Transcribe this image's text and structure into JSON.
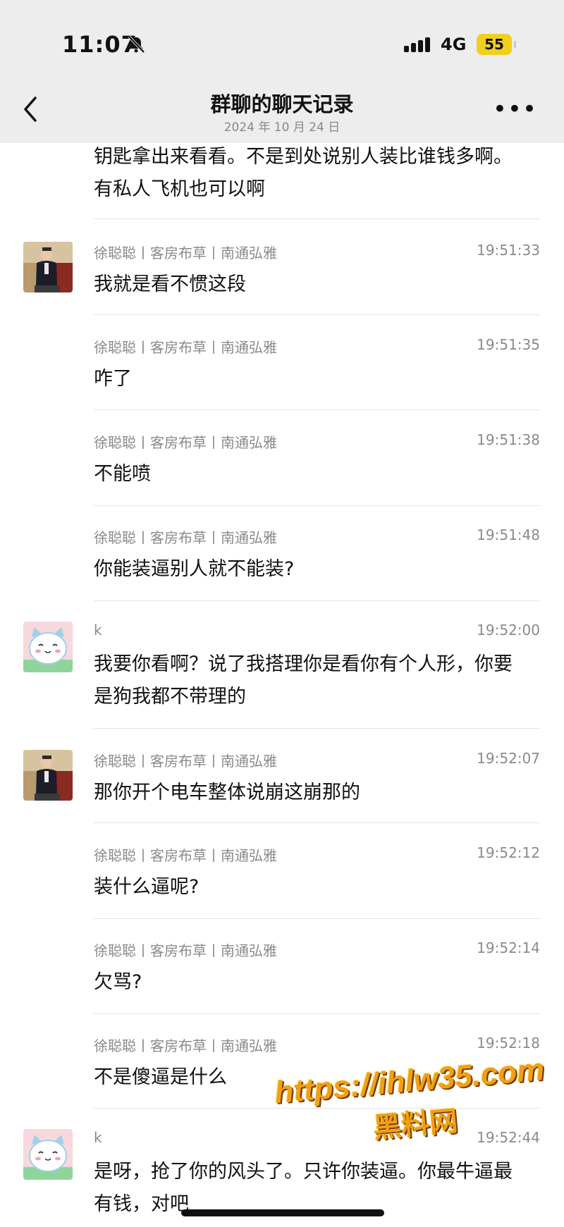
{
  "status": {
    "time": "11:07",
    "network": "4G",
    "battery": "55"
  },
  "header": {
    "title": "群聊的聊天记录",
    "date": "2024 年 10 月 24 日"
  },
  "continued_text": "钥匙拿出来看看。不是到处说别人装比谁钱多啊。有私人飞机也可以啊",
  "messages": [
    {
      "sender": "徐聪聪丨客房布草丨南通弘雅",
      "time": "19:51:33",
      "text": "我就是看不惯这段"
    },
    {
      "sender": "徐聪聪丨客房布草丨南通弘雅",
      "time": "19:51:35",
      "text": "咋了"
    },
    {
      "sender": "徐聪聪丨客房布草丨南通弘雅",
      "time": "19:51:38",
      "text": "不能喷"
    },
    {
      "sender": "徐聪聪丨客房布草丨南通弘雅",
      "time": "19:51:48",
      "text": "你能装逼别人就不能装?"
    },
    {
      "sender": "k",
      "time": "19:52:00",
      "text": "我要你看啊？说了我搭理你是看你有个人形，你要是狗我都不带理的"
    },
    {
      "sender": "徐聪聪丨客房布草丨南通弘雅",
      "time": "19:52:07",
      "text": "那你开个电车整体说崩这崩那的"
    },
    {
      "sender": "徐聪聪丨客房布草丨南通弘雅",
      "time": "19:52:12",
      "text": "装什么逼呢?"
    },
    {
      "sender": "徐聪聪丨客房布草丨南通弘雅",
      "time": "19:52:14",
      "text": "欠骂?"
    },
    {
      "sender": "徐聪聪丨客房布草丨南通弘雅",
      "time": "19:52:18",
      "text": "不是傻逼是什么"
    },
    {
      "sender": "k",
      "time": "19:52:44",
      "text": "是呀，抢了你的风头了。只许你装逼。你最牛逼最有钱，对吧"
    }
  ],
  "watermark": {
    "line1": "https://ihlw35.com",
    "line2": "黑料网"
  }
}
